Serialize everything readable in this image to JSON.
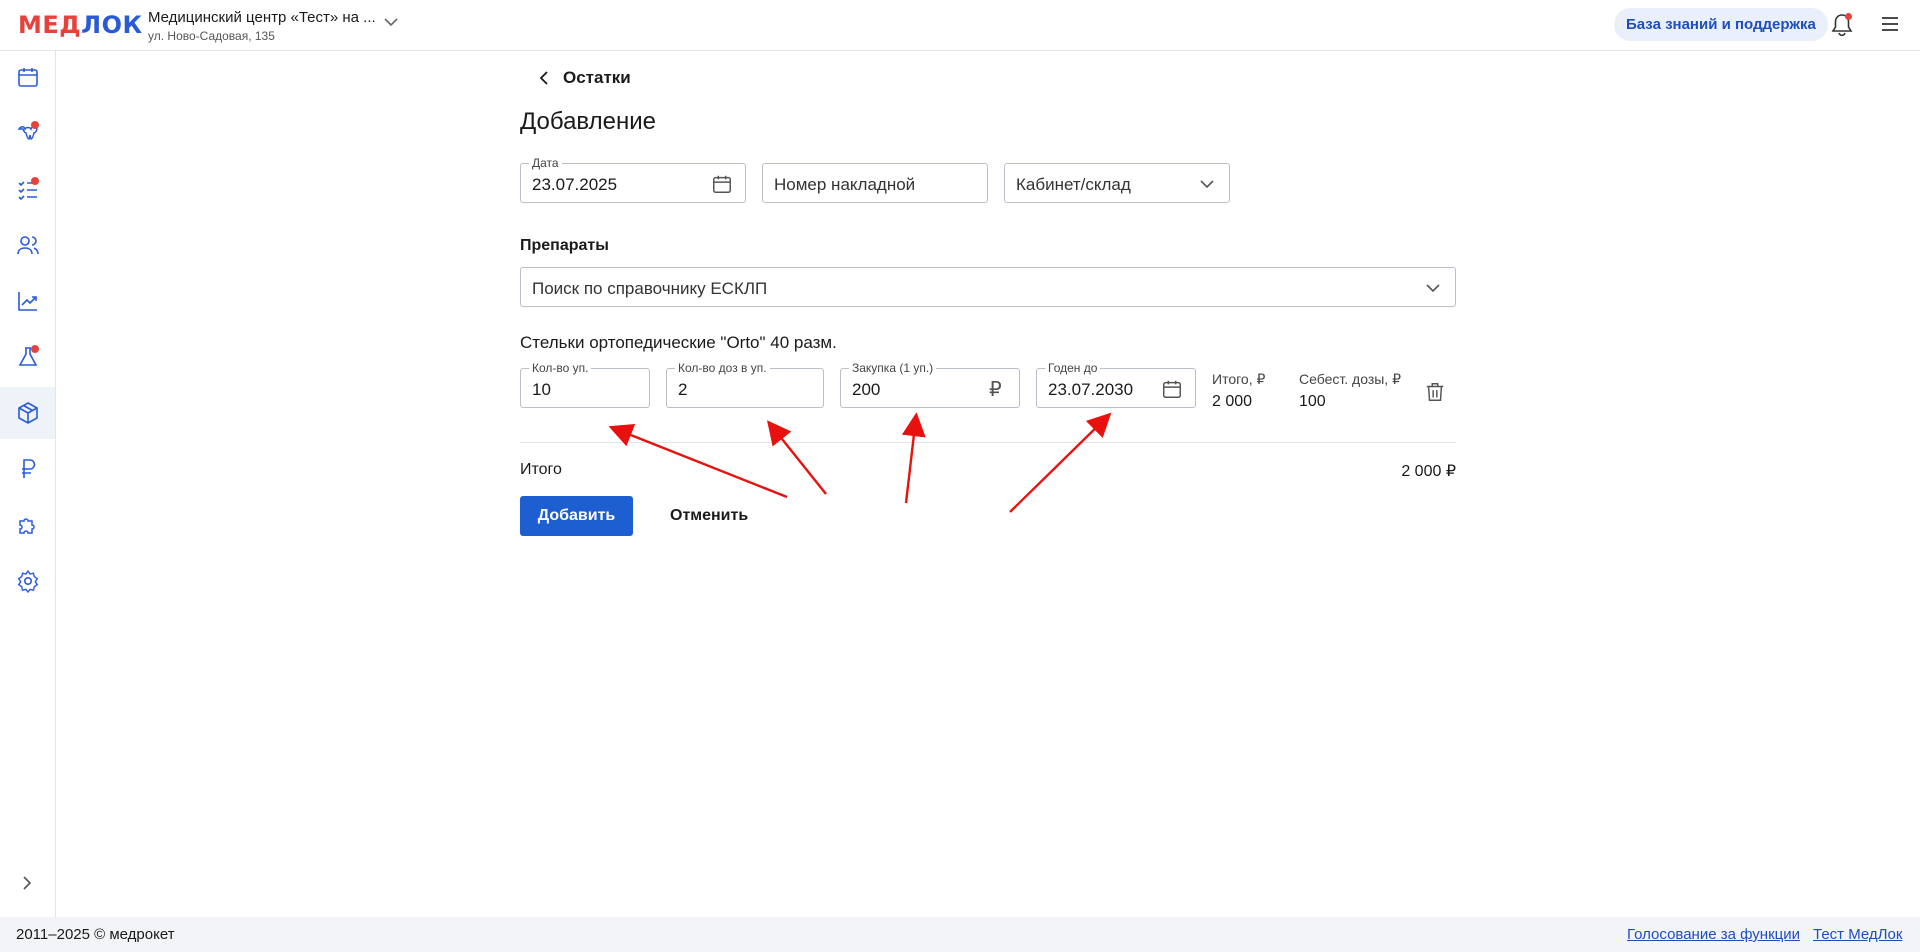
{
  "header": {
    "logo_prefix": "МЕД",
    "logo_suffix": "ЛОК",
    "clinic_name": "Медицинский центр «Тест» на ...",
    "clinic_address": "ул. Ново-Садовая, 135",
    "support_button": "База знаний и поддержка"
  },
  "sidebar": {
    "items": [
      {
        "icon": "calendar-icon",
        "badge": false
      },
      {
        "icon": "teeth-icon",
        "badge": true
      },
      {
        "icon": "checklist-icon",
        "badge": true
      },
      {
        "icon": "users-icon",
        "badge": false
      },
      {
        "icon": "chart-icon",
        "badge": false
      },
      {
        "icon": "flask-icon",
        "badge": true
      },
      {
        "icon": "box-icon",
        "badge": false,
        "active": true
      },
      {
        "icon": "ruble-icon",
        "badge": false
      },
      {
        "icon": "puzzle-icon",
        "badge": false
      },
      {
        "icon": "gear-icon",
        "badge": false
      }
    ]
  },
  "page": {
    "back_label": "Остатки",
    "title": "Добавление"
  },
  "form": {
    "date_label": "Дата",
    "date_value": "23.07.2025",
    "invoice_placeholder": "Номер накладной",
    "cabinet_placeholder": "Кабинет/склад",
    "section_title": "Препараты",
    "search_placeholder": "Поиск по справочнику ЕСКЛП"
  },
  "item": {
    "name": "Стельки ортопедические \"Orto\" 40 разм.",
    "qty_label": "Кол-во уп.",
    "qty_value": "10",
    "doses_label": "Кол-во доз в уп.",
    "doses_value": "2",
    "price_label": "Закупка (1 уп.)",
    "price_value": "200",
    "currency_symbol": "₽",
    "expiry_label": "Годен до",
    "expiry_value": "23.07.2030",
    "total_label": "Итого, ₽",
    "total_value": "2 000",
    "dose_cost_label": "Себест. дозы, ₽",
    "dose_cost_value": "100"
  },
  "summary": {
    "total_label": "Итого",
    "total_value": "2 000 ₽"
  },
  "actions": {
    "add": "Добавить",
    "cancel": "Отменить"
  },
  "footer": {
    "copyright": "2011–2025 © медрокет",
    "link_vote": "Голосование за функции",
    "link_test": "Тест МедЛок"
  },
  "colors": {
    "accent": "#1d5fd0",
    "brand_red": "#e8413b",
    "annotation_arrow": "#e8110f"
  }
}
